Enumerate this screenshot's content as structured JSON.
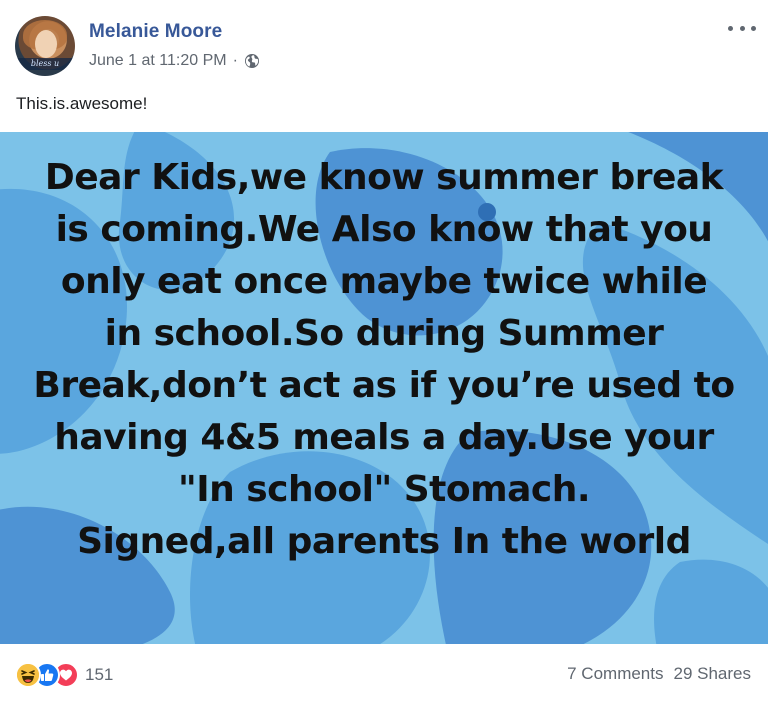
{
  "post": {
    "author": "Melanie Moore",
    "timestamp": "June 1 at 11:20 PM",
    "separator": "·",
    "privacy_icon": "globe-icon",
    "avatar_caption": "bless u",
    "caption": "This.is.awesome!"
  },
  "image": {
    "lines": [
      "Dear Kids,we know summer break",
      "is coming.We Also know that you",
      "only eat once maybe twice while",
      "in school.So during Summer",
      "Break,don’t act as if you’re used to",
      "having 4&5 meals a day.Use your",
      "\"In school\" Stomach.",
      "Signed,all parents In the world"
    ],
    "background_colors": [
      "#7cc2e8",
      "#4e93d4"
    ]
  },
  "footer": {
    "reaction_icons": [
      "haha-icon",
      "like-icon",
      "love-icon"
    ],
    "reaction_count": "151",
    "comments": "7 Comments",
    "shares": "29 Shares"
  },
  "colors": {
    "author_link": "#385898",
    "meta_text": "#606770",
    "like_blue": "#1877f2",
    "love_red": "#f33e58",
    "haha_yellow": "#f7c142"
  }
}
